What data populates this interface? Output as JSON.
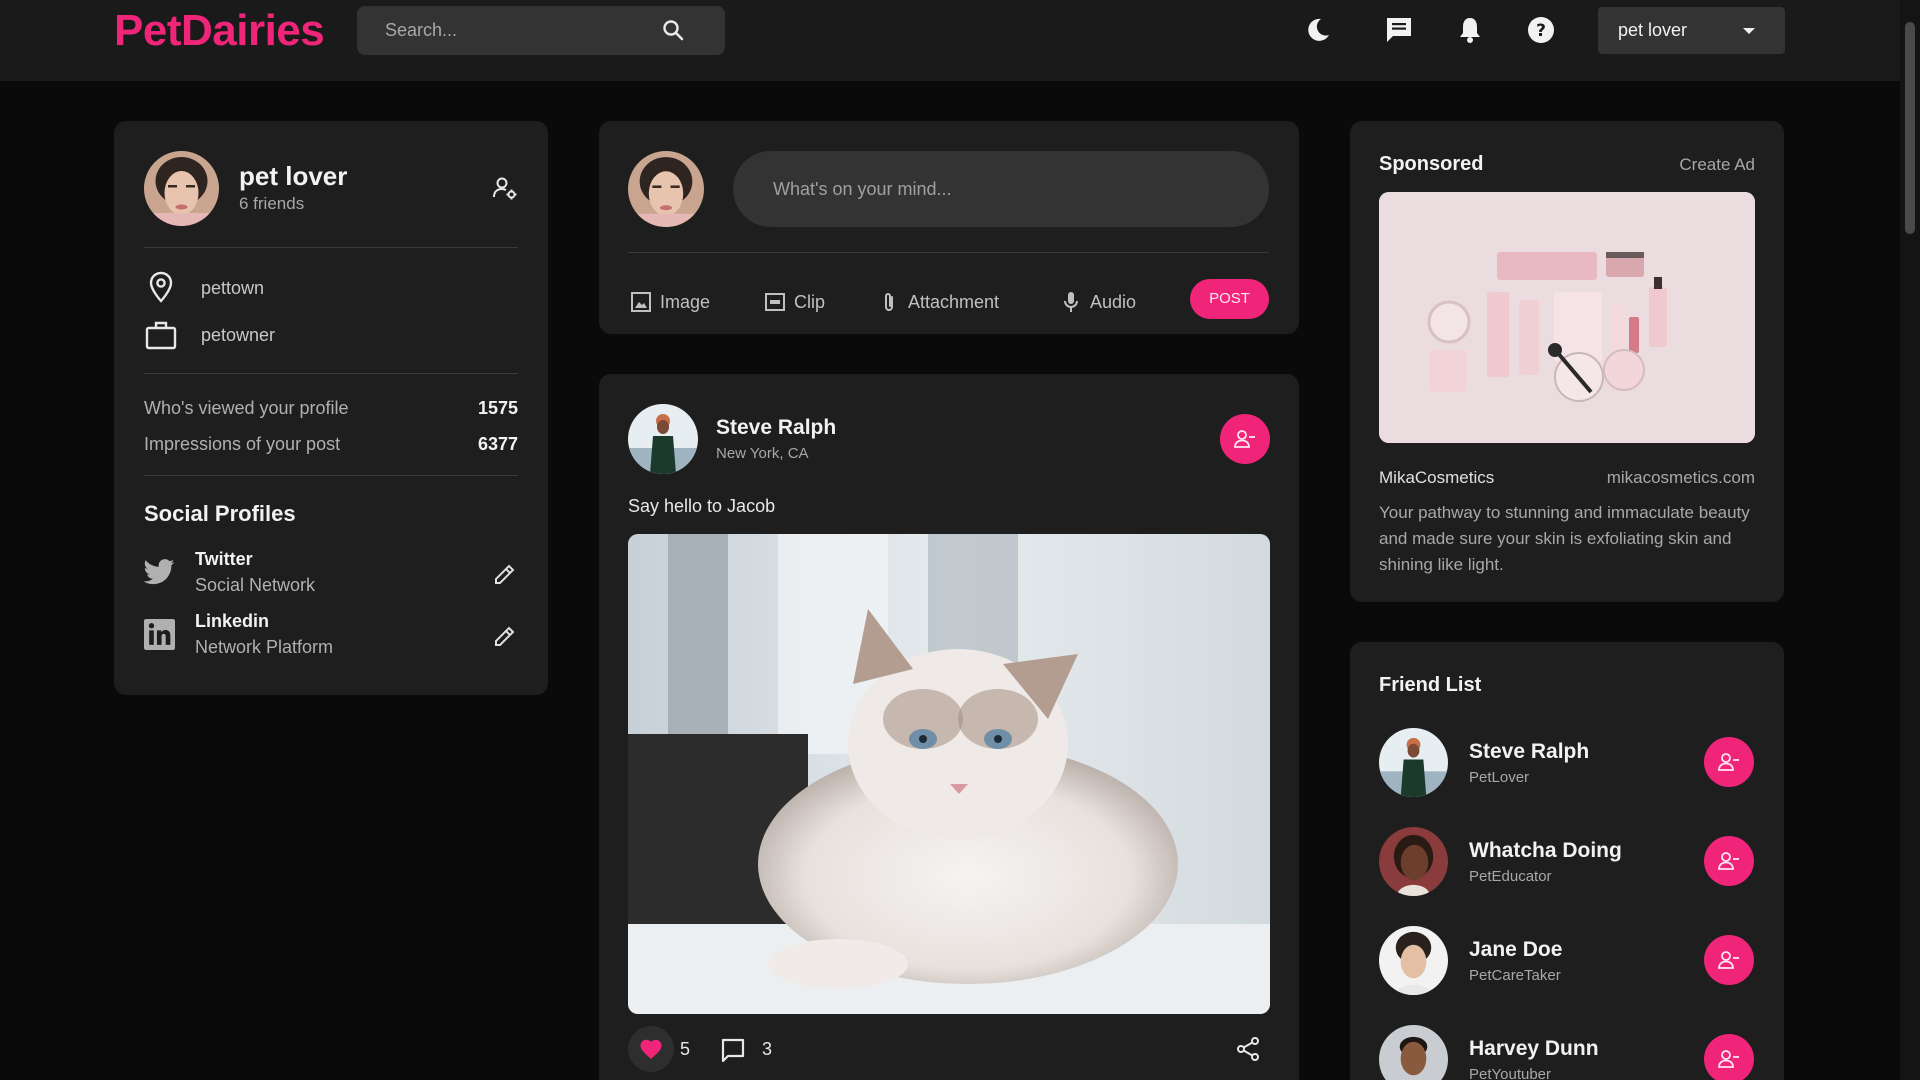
{
  "app": {
    "logo": "PetDairies"
  },
  "navbar": {
    "search_placeholder": "Search...",
    "user_menu_label": "pet lover",
    "icons": [
      "moon-icon",
      "chat-icon",
      "bell-icon",
      "help-icon"
    ]
  },
  "profile": {
    "name": "pet lover",
    "friends": "6 friends",
    "location": "pettown",
    "occupation": "petowner",
    "stats": [
      {
        "label": "Who's viewed your profile",
        "value": "1575"
      },
      {
        "label": "Impressions of your post",
        "value": "6377"
      }
    ],
    "social_title": "Social Profiles",
    "social": [
      {
        "name": "Twitter",
        "sub": "Social Network"
      },
      {
        "name": "Linkedin",
        "sub": "Network Platform"
      }
    ]
  },
  "composer": {
    "placeholder": "What's on your mind...",
    "actions": [
      "Image",
      "Clip",
      "Attachment",
      "Audio"
    ],
    "post_label": "POST"
  },
  "post": {
    "author": "Steve Ralph",
    "location": "New York, CA",
    "text": "Say hello to Jacob",
    "likes": "5",
    "comments": "3"
  },
  "sponsored": {
    "title": "Sponsored",
    "create_ad": "Create Ad",
    "brand": "MikaCosmetics",
    "url": "mikacosmetics.com",
    "description": "Your pathway to stunning and immaculate beauty and made sure your skin is exfoliating skin and shining like light."
  },
  "friend_list": {
    "title": "Friend List",
    "friends": [
      {
        "name": "Steve Ralph",
        "role": "PetLover"
      },
      {
        "name": "Whatcha Doing",
        "role": "PetEducator"
      },
      {
        "name": "Jane Doe",
        "role": "PetCareTaker"
      },
      {
        "name": "Harvey Dunn",
        "role": "PetYoutuber"
      }
    ]
  },
  "colors": {
    "accent": "#f0257a",
    "card": "#1e1e1e",
    "background": "#0a0a0a",
    "navbar": "#1a1a1a"
  }
}
